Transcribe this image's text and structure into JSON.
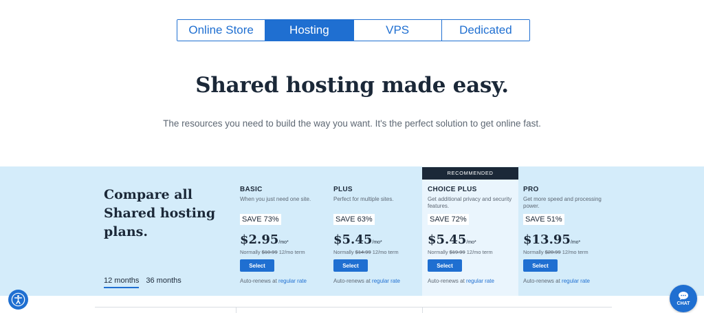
{
  "tabs": [
    {
      "label": "Online Store",
      "active": false
    },
    {
      "label": "Hosting",
      "active": true
    },
    {
      "label": "VPS",
      "active": false
    },
    {
      "label": "Dedicated",
      "active": false
    }
  ],
  "hero": {
    "headline": "Shared hosting made easy.",
    "subline": "The resources you need to build the way you want. It's the perfect solution to get online fast."
  },
  "compare": {
    "title": "Compare all Shared hosting plans.",
    "terms": [
      {
        "label": "12 months",
        "active": true
      },
      {
        "label": "36 months",
        "active": false
      }
    ],
    "recommended_label": "RECOMMENDED"
  },
  "plans": [
    {
      "name": "BASIC",
      "desc": "When you just need one site.",
      "save": "SAVE 73%",
      "price": "$2.95",
      "per": "/mo*",
      "normally_prefix": "Normally",
      "normally_price": "$10.99",
      "normally_suffix": "12/mo term",
      "select": "Select",
      "renews_prefix": "Auto-renews at",
      "renews_link": "regular rate"
    },
    {
      "name": "PLUS",
      "desc": "Perfect for multiple sites.",
      "save": "SAVE 63%",
      "price": "$5.45",
      "per": "/mo*",
      "normally_prefix": "Normally",
      "normally_price": "$14.99",
      "normally_suffix": "12/mo term",
      "select": "Select",
      "renews_prefix": "Auto-renews at",
      "renews_link": "regular rate"
    },
    {
      "name": "CHOICE PLUS",
      "desc": "Get additional privacy and security features.",
      "save": "SAVE 72%",
      "price": "$5.45",
      "per": "/mo*",
      "normally_prefix": "Normally",
      "normally_price": "$19.99",
      "normally_suffix": "12/mo term",
      "select": "Select",
      "renews_prefix": "Auto-renews at",
      "renews_link": "regular rate"
    },
    {
      "name": "PRO",
      "desc": "Get more speed and processing power.",
      "save": "SAVE 51%",
      "price": "$13.95",
      "per": "/mo*",
      "normally_prefix": "Normally",
      "normally_price": "$28.99",
      "normally_suffix": "12/mo term",
      "select": "Select",
      "renews_prefix": "Auto-renews at",
      "renews_link": "regular rate"
    }
  ],
  "widgets": {
    "chat_label": "CHAT",
    "a11y_icon": "accessibility-icon",
    "chat_icon": "chat-bubble-icon"
  },
  "colors": {
    "accent": "#1f6fd1",
    "band": "#d4ecfa",
    "recommended_bg": "#1b2838"
  }
}
